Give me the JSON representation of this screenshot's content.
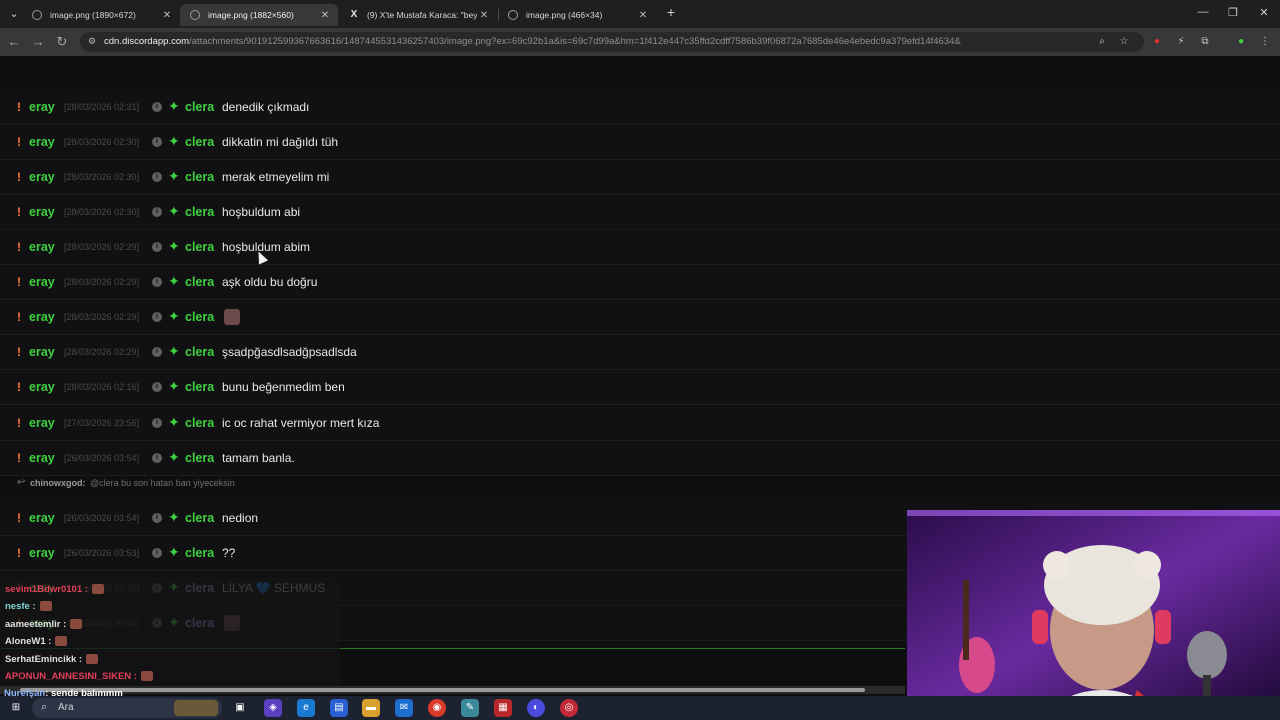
{
  "browser": {
    "tabs": [
      {
        "label": "image.png (1890×672)",
        "active": false,
        "icon": "image-tab-icon"
      },
      {
        "label": "image.png (1882×560)",
        "active": true,
        "icon": "image-tab-icon"
      },
      {
        "label": "(9) X'te Mustafa Karaca: \"beyle",
        "active": false,
        "icon": "x-icon"
      },
      {
        "label": "image.png (466×34)",
        "active": false,
        "icon": "image-tab-icon"
      }
    ],
    "url_host": "cdn.discordapp.com",
    "url_rest": "/attachments/901912599367663616/1487445531436257403/image.png?ex=69c92b1a&is=69c7d99a&hm=1f412e447c35ffd2cdff7586b39f06872a7685de46e4ebedc9a379efd14f4634&"
  },
  "chat_rows": [
    {
      "user": "eray",
      "ts": "[28/03/2026 02:31]",
      "mod": "clera",
      "msg": "denedik çıkmadı"
    },
    {
      "user": "eray",
      "ts": "[28/03/2026 02:30]",
      "mod": "clera",
      "msg": "dikkatin mi dağıldı tüh"
    },
    {
      "user": "eray",
      "ts": "[28/03/2026 02:30]",
      "mod": "clera",
      "msg": "merak etmeyelim mi"
    },
    {
      "user": "eray",
      "ts": "[28/03/2026 02:30]",
      "mod": "clera",
      "msg": "hoşbuldum abi"
    },
    {
      "user": "eray",
      "ts": "[28/03/2026 02:29]",
      "mod": "clera",
      "msg": "hoşbuldum abim"
    },
    {
      "user": "eray",
      "ts": "[28/03/2026 02:29]",
      "mod": "clera",
      "msg": "aşk oldu bu doğru"
    },
    {
      "user": "eray",
      "ts": "[28/03/2026 02:29]",
      "mod": "clera",
      "msg": ""
    },
    {
      "user": "eray",
      "ts": "[28/03/2026 02:29]",
      "mod": "clera",
      "msg": "şsadpğasdlsadğpsadlsda"
    },
    {
      "user": "eray",
      "ts": "[28/03/2026 02:16]",
      "mod": "clera",
      "msg": "bunu beğenmedim ben"
    },
    {
      "user": "eray",
      "ts": "[27/03/2026 23:56]",
      "mod": "clera",
      "msg": "ic oc rahat vermiyor mert kıza"
    },
    {
      "user": "eray",
      "ts": "[26/03/2026 03:54]",
      "mod": "clera",
      "msg": "tamam banla."
    }
  ],
  "reply": {
    "user": "chinowxgod:",
    "text": "@clera bu son hatan ban yiyeceksin"
  },
  "chat_rows_2": [
    {
      "user": "eray",
      "ts": "[26/03/2026 03:54]",
      "mod": "clera",
      "msg": "nedion"
    },
    {
      "user": "eray",
      "ts": "[26/03/2026 03:53]",
      "mod": "clera",
      "msg": "??"
    },
    {
      "user": "eray",
      "ts": "[26/03/2026 20:45]",
      "mod": "clera",
      "msg": "LİLYA 💙 SEHMUS"
    },
    {
      "user": "eray",
      "ts": "[26/03/2026 20:45]",
      "mod": "clera",
      "msg": ""
    }
  ],
  "stream_chat": [
    {
      "user": "nesfe :",
      "color": "#7fd3d3"
    },
    {
      "user": "aameetemlir :",
      "color": "#e0e0e0"
    },
    {
      "user": "AloneW1 :",
      "color": "#e0e0e0"
    },
    {
      "user": "SerhatEmincikk :",
      "color": "#e0e0e0"
    },
    {
      "user": "APONUN_ANNESINI_SIKEN :",
      "color": "#e0405a"
    },
    {
      "user": "Nurefşan",
      "color": "#8fb8ff",
      "text": ": sende balımmm"
    }
  ],
  "taskbar": {
    "search_label": "Ara"
  }
}
